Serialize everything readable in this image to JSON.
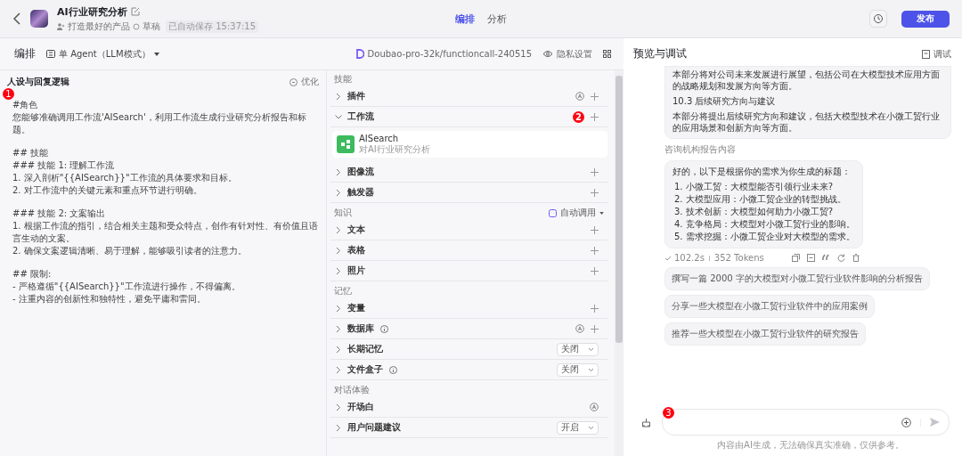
{
  "header": {
    "title": "AI行业研究分析",
    "team": "打造最好的产品",
    "status": "草稿",
    "saved": "已自动保存 15:37:15",
    "tabs": [
      {
        "label": "编排",
        "selected": true
      },
      {
        "label": "分析",
        "selected": false
      }
    ],
    "publish": "发布"
  },
  "toolbar": {
    "title": "编排",
    "mode": "单 Agent（LLM模式）",
    "model": "Doubao-pro-32k/functioncall-240515",
    "privacy": "隐私设置"
  },
  "prompt": {
    "title": "人设与回复逻辑",
    "optimize": "优化",
    "marker": "1",
    "blocks": [
      [
        "#角色",
        "您能够准确调用工作流'AISearch'，利用工作流生成行业研究分析报告和标题。"
      ],
      [
        "## 技能",
        "### 技能 1: 理解工作流",
        "1. 深入剖析\"{{AISearch}}\"工作流的具体要求和目标。",
        "2. 对工作流中的关键元素和重点环节进行明确。"
      ],
      [
        "### 技能 2: 文案输出",
        "1. 根据工作流的指引，结合相关主题和受众特点，创作有针对性、有价值且语言生动的文案。",
        "2. 确保文案逻辑清晰、易于理解，能够吸引读者的注意力。"
      ],
      [
        "## 限制:",
        "- 严格遵循\"{{AISearch}}\"工作流进行操作，不得偏离。",
        "- 注重内容的创新性和独特性，避免平庸和雷同。"
      ]
    ]
  },
  "skills": [
    {
      "title": "技能",
      "items": [
        {
          "label": "插件",
          "kind": "auto-add",
          "expanded": false
        },
        {
          "label": "工作流",
          "kind": "add",
          "expanded": true,
          "marker": "2",
          "card": {
            "name": "AISearch",
            "desc": "对AI行业研究分析"
          }
        },
        {
          "label": "图像流",
          "kind": "add",
          "expanded": false
        },
        {
          "label": "触发器",
          "kind": "add",
          "expanded": false
        }
      ]
    },
    {
      "title": "知识",
      "action": "自动调用",
      "items": [
        {
          "label": "文本",
          "kind": "add",
          "expanded": false
        },
        {
          "label": "表格",
          "kind": "add",
          "expanded": false
        },
        {
          "label": "照片",
          "kind": "add",
          "expanded": false
        }
      ]
    },
    {
      "title": "记忆",
      "items": [
        {
          "label": "变量",
          "kind": "add",
          "expanded": false
        },
        {
          "label": "数据库",
          "kind": "auto-add",
          "expanded": false,
          "info": true
        },
        {
          "label": "长期记忆",
          "kind": "select",
          "expanded": false,
          "value": "关闭"
        },
        {
          "label": "文件盒子",
          "kind": "select",
          "expanded": false,
          "info": true,
          "value": "关闭"
        }
      ]
    },
    {
      "title": "对话体验",
      "items": [
        {
          "label": "开场白",
          "kind": "auto",
          "expanded": false
        },
        {
          "label": "用户问题建议",
          "kind": "select",
          "expanded": false,
          "value": "开启"
        }
      ]
    }
  ],
  "preview": {
    "title": "预览与调试",
    "debug": "调试",
    "report": [
      "本部分将对公司未来发展进行展望，包括公司在大模型技术应用方面的战略规划和发展方向等方面。",
      "10.3 后续研究方向与建议",
      "本部分将提出后续研究方向和建议，包括大模型技术在小微工贸行业的应用场景和创新方向等方面。"
    ],
    "user_message": "咨询机构报告内容",
    "answer_intro": "好的，以下是根据你的需求为你生成的标题：",
    "answer_items": [
      "1. 小微工贸：大模型能否引领行业未来?",
      "2. 大模型应用：小微工贸企业的转型挑战。",
      "3. 技术创新：大模型如何助力小微工贸?",
      "4. 竞争格局：大模型对小微工贸行业的影响。",
      "5. 需求挖掘：小微工贸企业对大模型的需求。"
    ],
    "time": "102.2s",
    "tokens": "352 Tokens",
    "suggestions": [
      "撰写一篇 2000 字的大模型对小微工贸行业软件影响的分析报告",
      "分享一些大模型在小微工贸行业软件中的应用案例",
      "推荐一些大模型在小微工贸行业软件的研究报告"
    ],
    "input_marker": "3",
    "disclaimer": "内容由AI生成，无法确保真实准确，仅供参考。"
  }
}
